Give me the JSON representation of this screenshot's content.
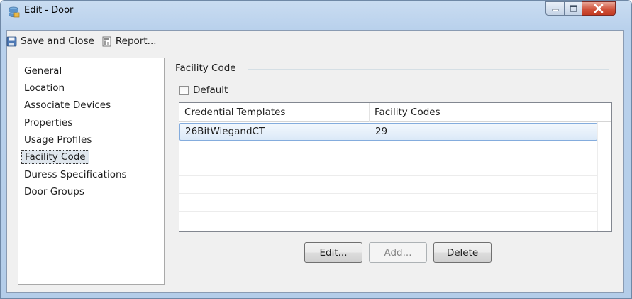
{
  "window": {
    "title": "Edit - Door",
    "icon": "database-icon"
  },
  "toolbar": {
    "save_close_label": "Save and Close",
    "save_icon": "floppy-disk-icon",
    "report_label": "Report...",
    "report_icon": "report-icon"
  },
  "nav": {
    "items": [
      {
        "label": "General"
      },
      {
        "label": "Location"
      },
      {
        "label": "Associate Devices"
      },
      {
        "label": "Properties"
      },
      {
        "label": "Usage Profiles"
      },
      {
        "label": "Facility Code",
        "selected": true
      },
      {
        "label": "Duress Specifications"
      },
      {
        "label": "Door Groups"
      }
    ]
  },
  "panel": {
    "title": "Facility Code",
    "default_checkbox": {
      "label": "Default",
      "checked": false
    },
    "grid": {
      "columns": [
        "Credential Templates",
        "Facility Codes"
      ],
      "rows": [
        {
          "template": "26BitWiegandCT",
          "code": "29",
          "selected": true
        }
      ]
    },
    "buttons": {
      "edit": "Edit...",
      "add": "Add...",
      "delete": "Delete"
    }
  },
  "colors": {
    "selection_border": "#84acdd",
    "close_button": "#c33b22"
  }
}
